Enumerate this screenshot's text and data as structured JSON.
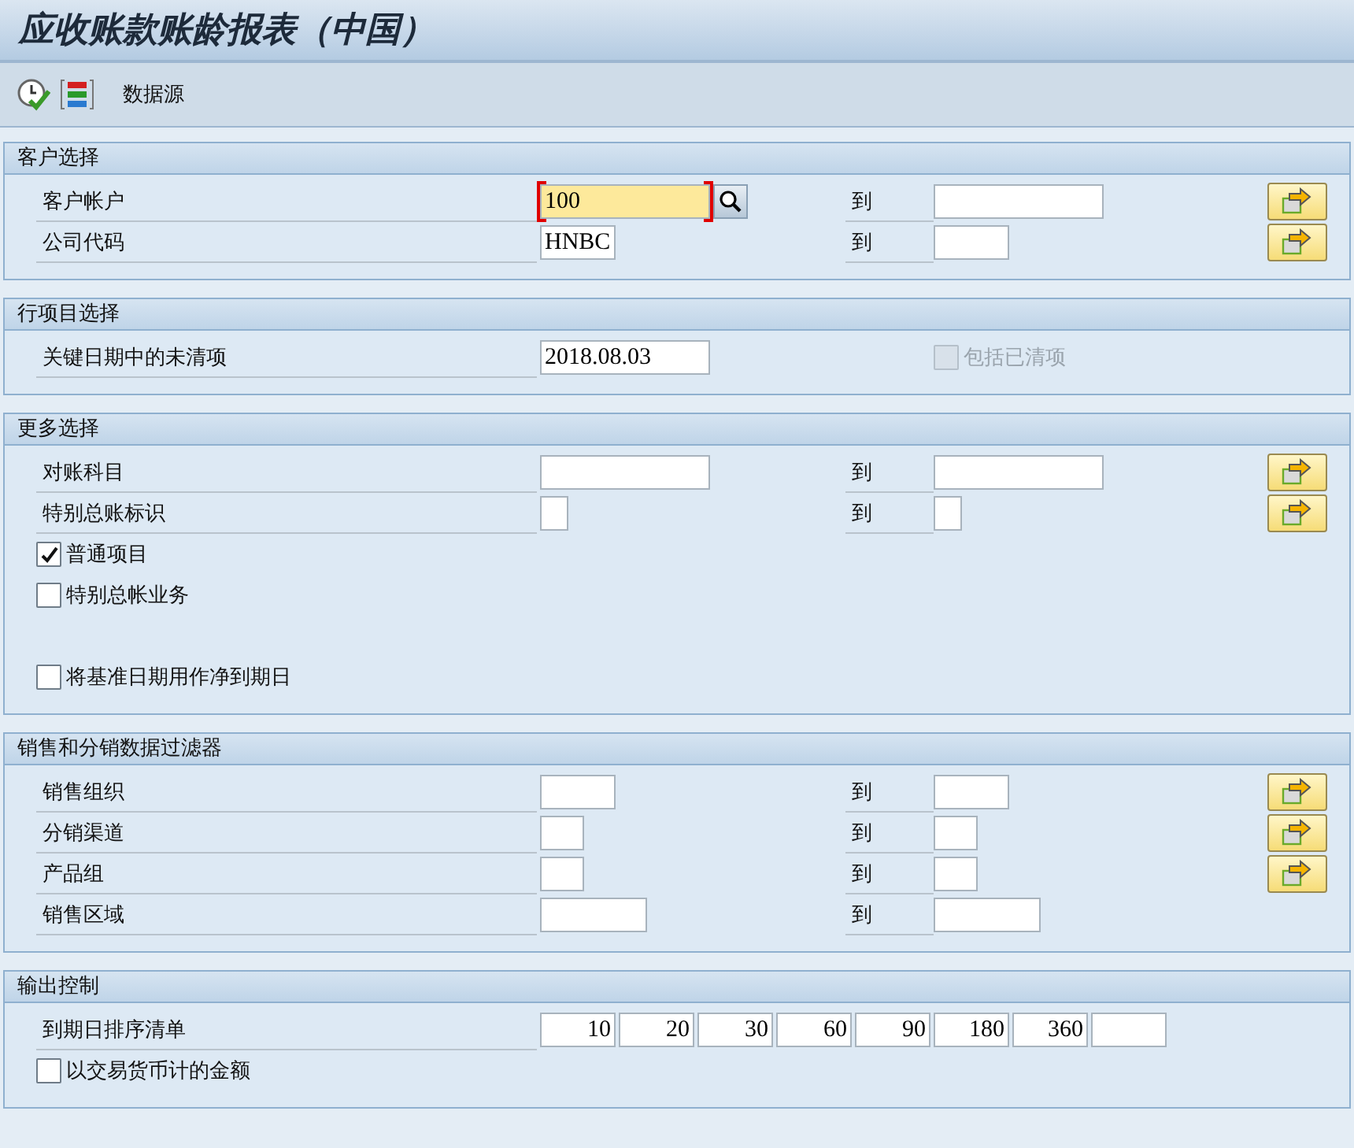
{
  "window": {
    "title": "应收账款账龄报表（中国）"
  },
  "toolbar": {
    "items": [
      {
        "kind": "execute-icon"
      },
      {
        "kind": "list-icon"
      },
      {
        "kind": "text",
        "label": "数据源"
      }
    ]
  },
  "groups": [
    {
      "title": "客户选择",
      "rows": [
        {
          "kind": "range",
          "label": "客户帐户",
          "low": "100",
          "focused": true,
          "to": "到",
          "multi": true
        },
        {
          "kind": "range",
          "label": "公司代码",
          "low": "HNBC",
          "to": "到",
          "multi": true
        }
      ]
    },
    {
      "title": "行项目选择",
      "rows": [
        {
          "kind": "param",
          "label": "关键日期中的未清项",
          "low": "2018.08.03",
          "check": {
            "label": "包括已清项",
            "checked": false,
            "disabled": true
          }
        }
      ]
    },
    {
      "title": "更多选择",
      "rows": [
        {
          "kind": "range",
          "label": "对账科目",
          "to": "到",
          "multi": true
        },
        {
          "kind": "range",
          "label": "特别总账标识",
          "to": "到",
          "multi": true
        },
        {
          "kind": "checkbox",
          "label": "普通项目",
          "checked": true,
          "disabled": false
        },
        {
          "kind": "checkbox",
          "label": "特别总帐业务",
          "checked": false,
          "disabled": false
        },
        {
          "kind": "blank"
        },
        {
          "kind": "checkbox",
          "label": "将基准日期用作净到期日",
          "checked": false,
          "disabled": false
        }
      ]
    },
    {
      "title": "销售和分销数据过滤器",
      "rows": [
        {
          "kind": "range",
          "label": "销售组织",
          "to": "到",
          "multi": true
        },
        {
          "kind": "range",
          "label": "分销渠道",
          "to": "到",
          "multi": true
        },
        {
          "kind": "range",
          "label": "产品组",
          "to": "到",
          "multi": true
        },
        {
          "kind": "range",
          "label": "销售区域",
          "to": "到",
          "multi": false
        }
      ]
    },
    {
      "title": "输出控制",
      "rows": [
        {
          "kind": "series",
          "label": "到期日排序清单",
          "values": [
            "10",
            "20",
            "30",
            "60",
            "90",
            "180",
            "360"
          ]
        },
        {
          "kind": "checkbox",
          "label": "以交易货币计的金额",
          "checked": false,
          "disabled": false
        }
      ]
    }
  ]
}
